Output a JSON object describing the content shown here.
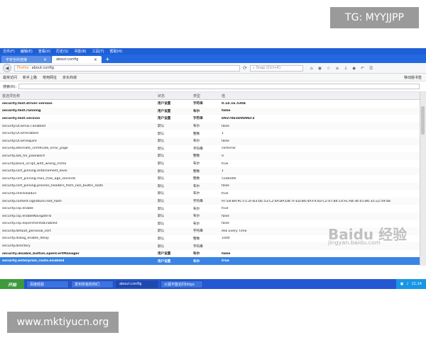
{
  "watermarks": {
    "tg": "TG: MYYJJPP",
    "site": "www.mktiyucn.org",
    "baidu": "Baidu 经验",
    "baidu_url": "jingyan.baidu.com"
  },
  "menubar": [
    "文件(F)",
    "编辑(E)",
    "查看(V)",
    "历史(S)",
    "书签(B)",
    "工具(T)",
    "帮助(H)"
  ],
  "tabs": [
    {
      "label": "不安全的连接",
      "active": false
    },
    {
      "label": "about:config",
      "active": true
    }
  ],
  "navbar": {
    "url_prefix": "Firefox",
    "url": "about:config",
    "search_placeholder": "Snap (Ctrl+K)"
  },
  "bookmarks": [
    "最常访问",
    "新手上路",
    "常用网址",
    "京东商城"
  ],
  "bookmarks_mobile": "移动版书签",
  "filter": {
    "label": "搜索(R):",
    "value": ""
  },
  "table": {
    "headers": [
      "首选项名称",
      "状态",
      "类型",
      "值"
    ],
    "rows": [
      {
        "name": "security.test.driver-version",
        "status": "用户设置",
        "type": "字符串",
        "value": "0.14.16.5304",
        "bold": true
      },
      {
        "name": "security.test.running",
        "status": "用户设置",
        "type": "布尔",
        "value": "false",
        "bold": true
      },
      {
        "name": "security.test.version",
        "status": "用户设置",
        "type": "字符串",
        "value": "D9378E5D0D9EF3",
        "bold": true
      },
      {
        "name": "security.OCSP.GET.enabled",
        "status": "默认",
        "type": "布尔",
        "value": "false"
      },
      {
        "name": "security.OCSP.enabled",
        "status": "默认",
        "type": "整数",
        "value": "1"
      },
      {
        "name": "security.OCSP.require",
        "status": "默认",
        "type": "布尔",
        "value": "false"
      },
      {
        "name": "security.alternate_certificate_error_page",
        "status": "默认",
        "type": "字符串",
        "value": "certerror"
      },
      {
        "name": "security.ask_for_password",
        "status": "默认",
        "type": "整数",
        "value": "0"
      },
      {
        "name": "security.block_script_with_wrong_mime",
        "status": "默认",
        "type": "布尔",
        "value": "true"
      },
      {
        "name": "security.cert_pinning.enforcement_level",
        "status": "默认",
        "type": "整数",
        "value": "1"
      },
      {
        "name": "security.cert_pinning.max_max_age_seconds",
        "status": "默认",
        "type": "整数",
        "value": "5184000"
      },
      {
        "name": "security.cert_pinning.process_headers_from_non_builtin_roots",
        "status": "默认",
        "type": "布尔",
        "value": "false"
      },
      {
        "name": "security.checkloaduri",
        "status": "默认",
        "type": "布尔",
        "value": "true"
      },
      {
        "name": "security.content.signature.root_hash",
        "status": "默认",
        "type": "字符串",
        "value": "97:E8:BA:9C:F1:2F:B3:DE:53:C2:4A:BA:D8:7F:ED:B6:4A:F4:83:C2:47:B4:14:FE:A8:36:01:B6:35:22:59:4B"
      },
      {
        "name": "security.csp.enable",
        "status": "默认",
        "type": "布尔",
        "value": "true"
      },
      {
        "name": "security.csp.enableNavigateTo",
        "status": "默认",
        "type": "布尔",
        "value": "false"
      },
      {
        "name": "security.csp.experimentalEnabled",
        "status": "默认",
        "type": "布尔",
        "value": "false"
      },
      {
        "name": "security.default_personal_cert",
        "status": "默认",
        "type": "字符串",
        "value": "Ask Every Time"
      },
      {
        "name": "security.dialog_enable_delay",
        "status": "默认",
        "type": "整数",
        "value": "1000"
      },
      {
        "name": "security.directory",
        "status": "默认",
        "type": "字符串",
        "value": ""
      },
      {
        "name": "security.disable_button.openCertManager",
        "status": "用户设置",
        "type": "布尔",
        "value": "false",
        "bold": true
      },
      {
        "name": "security.enterprise_roots.enabled",
        "status": "用户设置",
        "type": "布尔",
        "value": "true",
        "selected": true
      }
    ]
  },
  "taskbar": {
    "start": "开始",
    "items": [
      {
        "label": "百度经验",
        "active": false
      },
      {
        "label": "发布所有的你们",
        "active": false
      },
      {
        "label": "about:config",
        "active": true
      },
      {
        "label": "火狐不能访问https",
        "active": false
      }
    ],
    "clock": "21:14"
  }
}
